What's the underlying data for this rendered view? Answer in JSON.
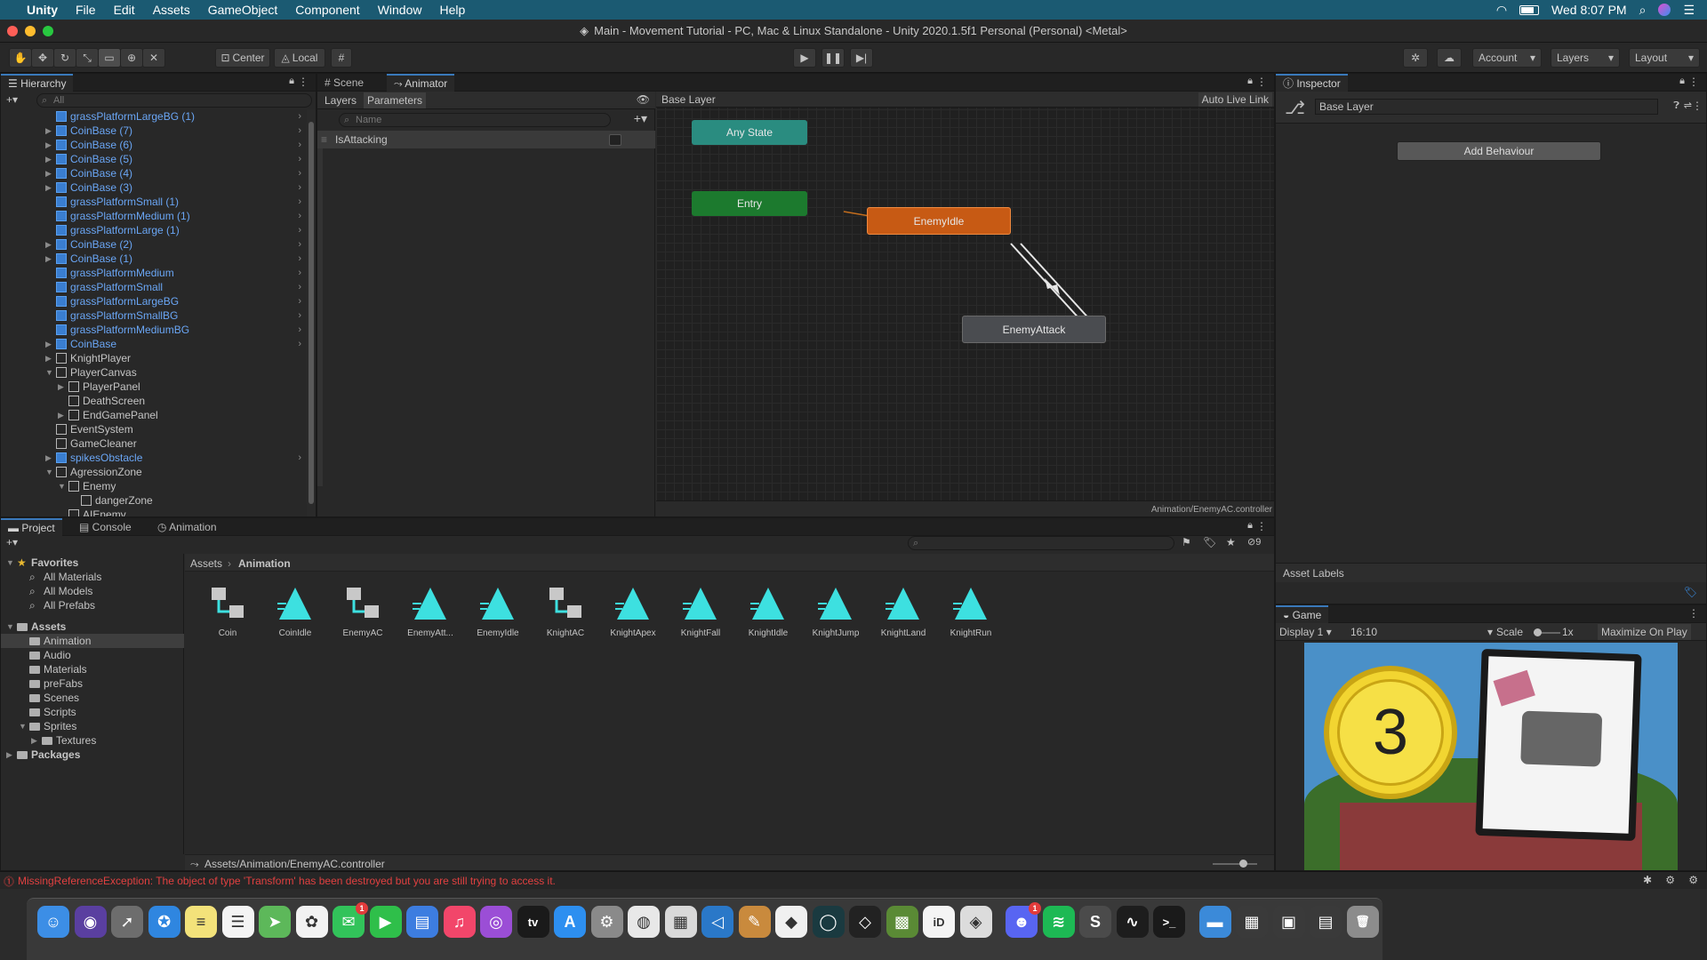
{
  "menubar": {
    "apple": "",
    "items": [
      "Unity",
      "File",
      "Edit",
      "Assets",
      "GameObject",
      "Component",
      "Window",
      "Help"
    ],
    "clock": "Wed 8:07 PM"
  },
  "window": {
    "title": "Main - Movement Tutorial - PC, Mac & Linux Standalone - Unity 2020.1.5f1 Personal (Personal) <Metal>"
  },
  "toolbar": {
    "pivot": "Center",
    "space": "Local",
    "account": "Account",
    "layers": "Layers",
    "layout": "Layout"
  },
  "hierarchy": {
    "title": "Hierarchy",
    "search_placeholder": "All",
    "rows": [
      {
        "name": "grassPlatformLargeBG (1)",
        "indent": 1,
        "arrow": "",
        "prefab": true,
        "chev": true
      },
      {
        "name": "CoinBase (7)",
        "indent": 1,
        "arrow": "▶",
        "prefab": true,
        "chev": true
      },
      {
        "name": "CoinBase (6)",
        "indent": 1,
        "arrow": "▶",
        "prefab": true,
        "chev": true
      },
      {
        "name": "CoinBase (5)",
        "indent": 1,
        "arrow": "▶",
        "prefab": true,
        "chev": true
      },
      {
        "name": "CoinBase (4)",
        "indent": 1,
        "arrow": "▶",
        "prefab": true,
        "chev": true
      },
      {
        "name": "CoinBase (3)",
        "indent": 1,
        "arrow": "▶",
        "prefab": true,
        "chev": true
      },
      {
        "name": "grassPlatformSmall (1)",
        "indent": 1,
        "arrow": "",
        "prefab": true,
        "chev": true
      },
      {
        "name": "grassPlatformMedium (1)",
        "indent": 1,
        "arrow": "",
        "prefab": true,
        "chev": true
      },
      {
        "name": "grassPlatformLarge (1)",
        "indent": 1,
        "arrow": "",
        "prefab": true,
        "chev": true
      },
      {
        "name": "CoinBase (2)",
        "indent": 1,
        "arrow": "▶",
        "prefab": true,
        "chev": true
      },
      {
        "name": "CoinBase (1)",
        "indent": 1,
        "arrow": "▶",
        "prefab": true,
        "chev": true
      },
      {
        "name": "grassPlatformMedium",
        "indent": 1,
        "arrow": "",
        "prefab": true,
        "chev": true
      },
      {
        "name": "grassPlatformSmall",
        "indent": 1,
        "arrow": "",
        "prefab": true,
        "chev": true
      },
      {
        "name": "grassPlatformLargeBG",
        "indent": 1,
        "arrow": "",
        "prefab": true,
        "chev": true
      },
      {
        "name": "grassPlatformSmallBG",
        "indent": 1,
        "arrow": "",
        "prefab": true,
        "chev": true
      },
      {
        "name": "grassPlatformMediumBG",
        "indent": 1,
        "arrow": "",
        "prefab": true,
        "chev": true
      },
      {
        "name": "CoinBase",
        "indent": 1,
        "arrow": "▶",
        "prefab": true,
        "chev": true
      },
      {
        "name": "KnightPlayer",
        "indent": 1,
        "arrow": "▶",
        "prefab": false,
        "chev": false
      },
      {
        "name": "PlayerCanvas",
        "indent": 1,
        "arrow": "▼",
        "prefab": false,
        "chev": false
      },
      {
        "name": "PlayerPanel",
        "indent": 2,
        "arrow": "▶",
        "prefab": false,
        "chev": false
      },
      {
        "name": "DeathScreen",
        "indent": 2,
        "arrow": "",
        "prefab": false,
        "chev": false
      },
      {
        "name": "EndGamePanel",
        "indent": 2,
        "arrow": "▶",
        "prefab": false,
        "chev": false
      },
      {
        "name": "EventSystem",
        "indent": 1,
        "arrow": "",
        "prefab": false,
        "chev": false
      },
      {
        "name": "GameCleaner",
        "indent": 1,
        "arrow": "",
        "prefab": false,
        "chev": false
      },
      {
        "name": "spikesObstacle",
        "indent": 1,
        "arrow": "▶",
        "prefab": true,
        "chev": true
      },
      {
        "name": "AgressionZone",
        "indent": 1,
        "arrow": "▼",
        "prefab": false,
        "chev": false
      },
      {
        "name": "Enemy",
        "indent": 2,
        "arrow": "▼",
        "prefab": false,
        "chev": false
      },
      {
        "name": "dangerZone",
        "indent": 3,
        "arrow": "",
        "prefab": false,
        "chev": false
      },
      {
        "name": "AIEnemy",
        "indent": 2,
        "arrow": "",
        "prefab": false,
        "chev": false
      }
    ]
  },
  "animator": {
    "tabs": [
      "Scene",
      "Animator"
    ],
    "subtabs": [
      "Layers",
      "Parameters"
    ],
    "search_placeholder": "Name",
    "parameter": "IsAttacking",
    "breadcrumb": "Base Layer",
    "auto_live_link": "Auto Live Link",
    "states": {
      "any": "Any State",
      "entry": "Entry",
      "idle": "EnemyIdle",
      "attack": "EnemyAttack"
    },
    "footer_path": "Animation/EnemyAC.controller",
    "colors": {
      "any": "#2a8c80",
      "entry": "#1c7a2e",
      "idle": "#c75a14",
      "attack": "#4a4c50"
    }
  },
  "inspector": {
    "title": "Inspector",
    "object": "Base Layer",
    "add_behaviour": "Add Behaviour",
    "asset_labels": "Asset Labels"
  },
  "project": {
    "tabs": [
      "Project",
      "Console",
      "Animation"
    ],
    "breadcrumb": [
      "Assets",
      "Animation"
    ],
    "hidden_count": "9",
    "tree": [
      {
        "label": "Favorites",
        "level": 0,
        "arrow": "▼",
        "bold": true,
        "kind": "star"
      },
      {
        "label": "All Materials",
        "level": 1,
        "arrow": "",
        "bold": false,
        "kind": "search"
      },
      {
        "label": "All Models",
        "level": 1,
        "arrow": "",
        "bold": false,
        "kind": "search"
      },
      {
        "label": "All Prefabs",
        "level": 1,
        "arrow": "",
        "bold": false,
        "kind": "search"
      },
      {
        "label": "",
        "level": 0,
        "arrow": "",
        "bold": false,
        "kind": "spacer"
      },
      {
        "label": "Assets",
        "level": 0,
        "arrow": "▼",
        "bold": true,
        "kind": "folder"
      },
      {
        "label": "Animation",
        "level": 1,
        "arrow": "",
        "bold": false,
        "kind": "folder",
        "selected": true
      },
      {
        "label": "Audio",
        "level": 1,
        "arrow": "",
        "bold": false,
        "kind": "folder"
      },
      {
        "label": "Materials",
        "level": 1,
        "arrow": "",
        "bold": false,
        "kind": "folder"
      },
      {
        "label": "preFabs",
        "level": 1,
        "arrow": "",
        "bold": false,
        "kind": "folder"
      },
      {
        "label": "Scenes",
        "level": 1,
        "arrow": "",
        "bold": false,
        "kind": "folder"
      },
      {
        "label": "Scripts",
        "level": 1,
        "arrow": "",
        "bold": false,
        "kind": "folder"
      },
      {
        "label": "Sprites",
        "level": 1,
        "arrow": "▼",
        "bold": false,
        "kind": "folder"
      },
      {
        "label": "Textures",
        "level": 2,
        "arrow": "▶",
        "bold": false,
        "kind": "folder"
      },
      {
        "label": "Packages",
        "level": 0,
        "arrow": "▶",
        "bold": true,
        "kind": "folder"
      }
    ],
    "assets": [
      {
        "label": "Coin",
        "type": "controller"
      },
      {
        "label": "CoinIdle",
        "type": "clip"
      },
      {
        "label": "EnemyAC",
        "type": "controller"
      },
      {
        "label": "EnemyAtt...",
        "type": "clip"
      },
      {
        "label": "EnemyIdle",
        "type": "clip"
      },
      {
        "label": "KnightAC",
        "type": "controller"
      },
      {
        "label": "KnightApex",
        "type": "clip"
      },
      {
        "label": "KnightFall",
        "type": "clip"
      },
      {
        "label": "KnightIdle",
        "type": "clip"
      },
      {
        "label": "KnightJump",
        "type": "clip"
      },
      {
        "label": "KnightLand",
        "type": "clip"
      },
      {
        "label": "KnightRun",
        "type": "clip"
      }
    ],
    "footer_path": "Assets/Animation/EnemyAC.controller"
  },
  "game": {
    "title": "Game",
    "display": "Display 1",
    "aspect": "16:10",
    "scale_label": "Scale",
    "scale_value": "1x",
    "maximize": "Maximize On Play",
    "coin_count": "3"
  },
  "console_error": "MissingReferenceException: The object of type 'Transform' has been destroyed but you are still trying to access it.",
  "dock": {
    "apps": [
      {
        "name": "finder",
        "color": "#3c8ee6",
        "glyph": "☺"
      },
      {
        "name": "siri",
        "color": "#5a3fa0",
        "glyph": "◉"
      },
      {
        "name": "launchpad",
        "color": "#6d6d6d",
        "glyph": "➚"
      },
      {
        "name": "safari",
        "color": "#2f86e0",
        "glyph": "✪"
      },
      {
        "name": "notes",
        "color": "#f3e27a",
        "glyph": "≡"
      },
      {
        "name": "reminders",
        "color": "#f4f4f4",
        "glyph": "☰"
      },
      {
        "name": "maps",
        "color": "#5db85a",
        "glyph": "➤"
      },
      {
        "name": "photos",
        "color": "#f2f2f2",
        "glyph": "✿"
      },
      {
        "name": "messages",
        "color": "#32c35a",
        "glyph": "✉"
      },
      {
        "name": "facetime",
        "color": "#2fbf4a",
        "glyph": "▶"
      },
      {
        "name": "keynote",
        "color": "#3d7de0",
        "glyph": "▤"
      },
      {
        "name": "music",
        "color": "#f2466a",
        "glyph": "♫"
      },
      {
        "name": "podcasts",
        "color": "#9b4ed6",
        "glyph": "◎"
      },
      {
        "name": "apple-tv",
        "color": "#1a1a1a",
        "glyph": "tv"
      },
      {
        "name": "app-store",
        "color": "#2d8ff0",
        "glyph": "A"
      },
      {
        "name": "system-preferences",
        "color": "#8a8a8a",
        "glyph": "⚙"
      },
      {
        "name": "chrome",
        "color": "#e8e8e8",
        "glyph": "◍"
      },
      {
        "name": "preview",
        "color": "#d9d9d9",
        "glyph": "▦"
      },
      {
        "name": "vscode",
        "color": "#2a78c8",
        "glyph": "◁"
      },
      {
        "name": "paint",
        "color": "#c98a3d",
        "glyph": "✎"
      },
      {
        "name": "unity-hub",
        "color": "#f0f0f0",
        "glyph": "◆"
      },
      {
        "name": "gitkraken",
        "color": "#1a3a40",
        "glyph": "◯"
      },
      {
        "name": "unity",
        "color": "#222222",
        "glyph": "◇"
      },
      {
        "name": "minecraft",
        "color": "#5a8a35",
        "glyph": "▩"
      },
      {
        "name": "bankid",
        "color": "#f4f4f4",
        "glyph": "iD"
      },
      {
        "name": "dice",
        "color": "#dcdcdc",
        "glyph": "◈"
      },
      {
        "name": "discord",
        "color": "#5865f2",
        "glyph": "☻"
      },
      {
        "name": "spotify",
        "color": "#1db954",
        "glyph": "≋"
      },
      {
        "name": "sublime",
        "color": "#4b4b4b",
        "glyph": "S"
      },
      {
        "name": "activity-monitor",
        "color": "#1d1d1d",
        "glyph": "∿"
      },
      {
        "name": "terminal",
        "color": "#1a1a1a",
        "glyph": ">_"
      },
      {
        "name": "downloads-folder",
        "color": "#3b8ad9",
        "glyph": "▬"
      },
      {
        "name": "stack-1",
        "color": "#3a3a3a",
        "glyph": "▦"
      },
      {
        "name": "stack-2",
        "color": "#3a3a3a",
        "glyph": "▣"
      },
      {
        "name": "stack-3",
        "color": "#3a3a3a",
        "glyph": "▤"
      },
      {
        "name": "trash",
        "color": "#8c8c8c",
        "glyph": "🗑"
      }
    ],
    "badges": {
      "messages": "1",
      "discord": "1"
    }
  }
}
